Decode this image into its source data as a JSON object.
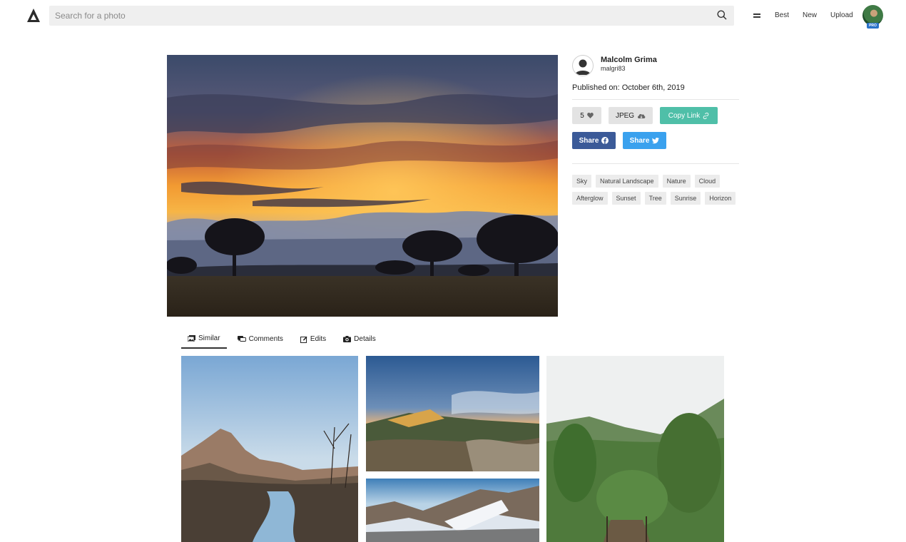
{
  "header": {
    "search_placeholder": "Search for a photo",
    "nav": [
      "Best",
      "New",
      "Upload"
    ],
    "pro_badge": "PRO"
  },
  "author": {
    "name": "Malcolm Grima",
    "username": "malgri83",
    "published": "Published on: October 6th, 2019"
  },
  "actions": {
    "likes": "5",
    "format": "JPEG",
    "copy_link": "Copy Link",
    "share_facebook": "Share",
    "share_twitter": "Share"
  },
  "tags": [
    "Sky",
    "Natural Landscape",
    "Nature",
    "Cloud",
    "Afterglow",
    "Sunset",
    "Tree",
    "Sunrise",
    "Horizon"
  ],
  "tabs": [
    {
      "label": "Similar",
      "icon": "images-icon",
      "active": true
    },
    {
      "label": "Comments",
      "icon": "comments-icon",
      "active": false
    },
    {
      "label": "Edits",
      "icon": "edit-icon",
      "active": false
    },
    {
      "label": "Details",
      "icon": "camera-icon",
      "active": false
    }
  ],
  "colors": {
    "teal": "#4fbfa8",
    "facebook": "#3b5a98",
    "twitter": "#3aa1ee",
    "pro": "#2a73c9"
  }
}
